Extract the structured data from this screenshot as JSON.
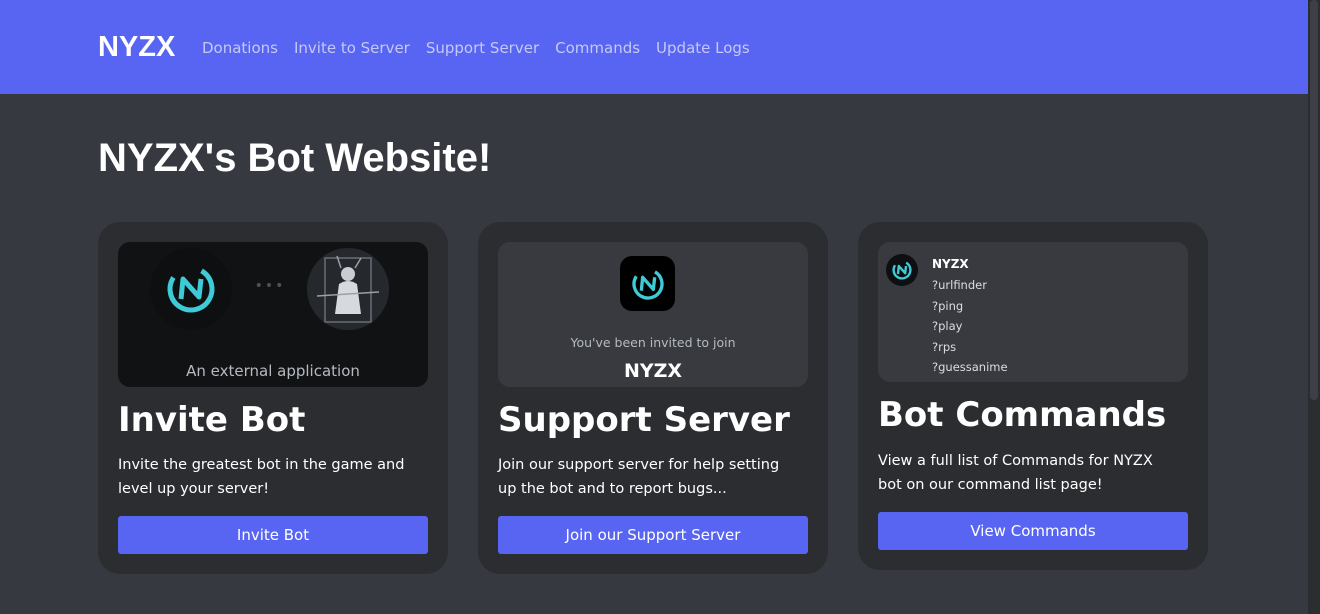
{
  "nav": {
    "brand": "NYZX",
    "links": [
      "Donations",
      "Invite to Server",
      "Support Server",
      "Commands",
      "Update Logs"
    ]
  },
  "page": {
    "title": "NYZX's Bot Website!"
  },
  "cards": [
    {
      "title": "Invite Bot",
      "text": "Invite the greatest bot in the game and level up your server!",
      "button": "Invite Bot",
      "media": {
        "dots": "•••",
        "caption": "An external application"
      }
    },
    {
      "title": "Support Server",
      "text": "Join our support server for help setting up the bot and to report bugs...",
      "button": "Join our Support Server",
      "media": {
        "invite_line": "You've been invited to join",
        "server_name": "NYZX"
      }
    },
    {
      "title": "Bot Commands",
      "text": "View a full list of Commands for NYZX bot on our command list page!",
      "button": "View Commands",
      "media": {
        "bot_name": "NYZX",
        "commands": [
          "?urlfinder",
          "?ping",
          "?play",
          "?rps",
          "?guessanime"
        ]
      }
    }
  ],
  "colors": {
    "accent": "#5865f2",
    "background": "#36393f",
    "card": "#2b2d31",
    "logo_teal": "#3ecad6"
  }
}
